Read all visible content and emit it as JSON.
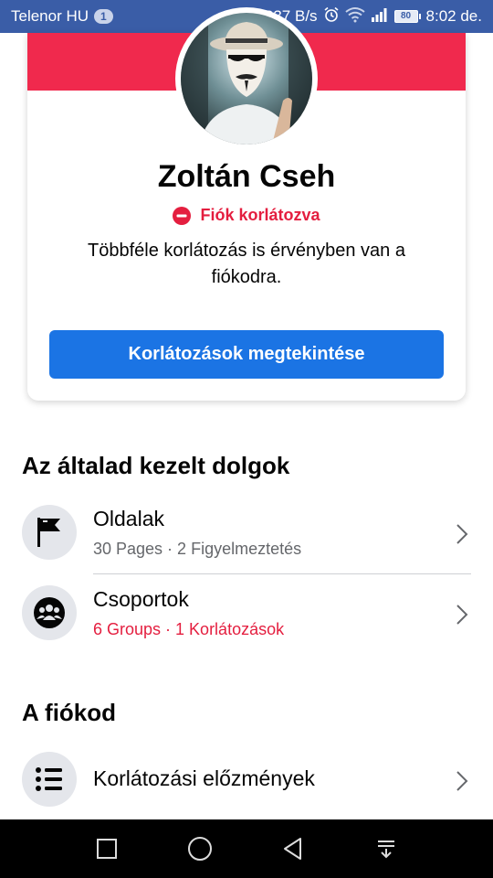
{
  "status_bar": {
    "carrier": "Telenor HU",
    "badge": "1",
    "speed": "237 B/s",
    "battery": "80",
    "time": "8:02 de."
  },
  "profile": {
    "name": "Zoltán Cseh",
    "restricted_label": "Fiók korlátozva",
    "description": "Többféle korlátozás is érvényben van a fiókodra.",
    "button_label": "Korlátozások megtekintése"
  },
  "managed": {
    "title": "Az általad kezelt dolgok",
    "items": [
      {
        "title": "Oldalak",
        "subtitle": "30 Pages · 2 Figyelmeztetés",
        "icon": "flag-icon",
        "alert": false
      },
      {
        "title": "Csoportok",
        "subtitle": "6 Groups · 1 Korlátozások",
        "icon": "groups-icon",
        "alert": true
      }
    ]
  },
  "account": {
    "title": "A fiókod",
    "items": [
      {
        "title": "Korlátozási előzmények",
        "icon": "list-icon"
      }
    ]
  },
  "colors": {
    "status_bar": "#3a5da7",
    "cover": "#f0294d",
    "primary_button": "#1b74e4",
    "alert_red": "#e41e3f"
  }
}
